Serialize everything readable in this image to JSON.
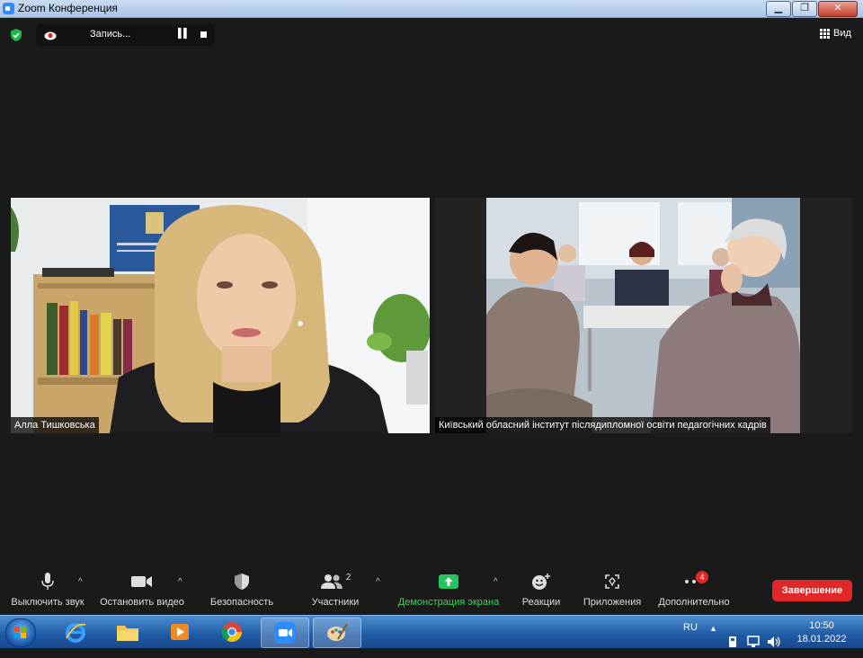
{
  "window": {
    "title": "Zoom Конференция",
    "buttons": [
      "minimize",
      "maximize",
      "close"
    ]
  },
  "top_bar": {
    "recording_label": "Запись...",
    "view_label": "Вид"
  },
  "participants": [
    {
      "name": "Алла Тишковська",
      "icon": "video-person"
    },
    {
      "name": "Київський обласний інститут післядипломної освіти педагогічних кадрів",
      "icon": "video-classroom"
    }
  ],
  "toolbar": {
    "mute": "Выключить звук",
    "stop_video": "Остановить видео",
    "security": "Безопасность",
    "participants": "Участники",
    "participants_count": "2",
    "share": "Демонстрация экрана",
    "reactions": "Реакции",
    "apps": "Приложения",
    "more": "Дополнительно",
    "more_badge": "4",
    "end": "Завершение"
  },
  "taskbar": {
    "language": "RU",
    "time": "10:50",
    "date": "18.01.2022"
  },
  "colors": {
    "background": "#1a1a1a",
    "accent_green": "#3cd35b",
    "end_red": "#e02828",
    "zoom_blue": "#2d8cff"
  }
}
